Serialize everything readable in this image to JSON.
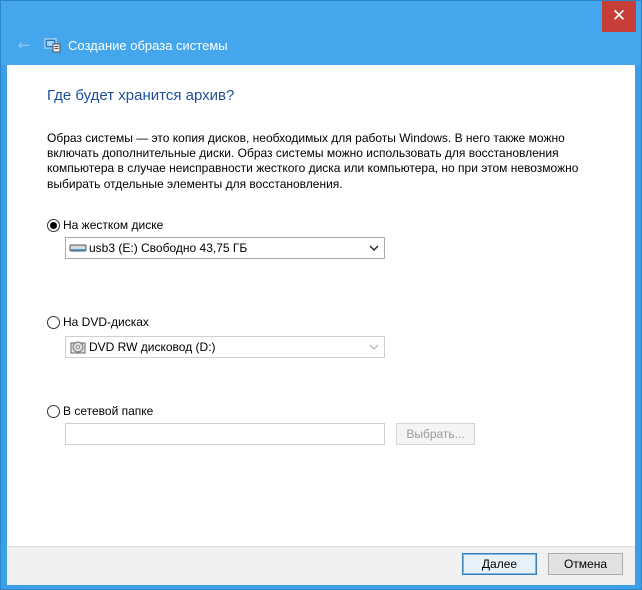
{
  "window": {
    "title": "Создание образа системы",
    "close_glyph": "✕",
    "back_glyph": "←",
    "accent_color": "#44a6ec",
    "close_color": "#c73e38"
  },
  "main": {
    "heading": "Где будет хранится архив?",
    "description": "Образ системы — это копия дисков, необходимых для работы Windows. В него также можно включать дополнительные диски. Образ системы можно использовать для восстановления компьютера в случае неисправности жесткого диска или компьютера, но при этом невозможно выбирать отдельные элементы для восстановления."
  },
  "options": {
    "hard_disk": {
      "label": "На жестком диске",
      "selected": true,
      "select_value": "usb3 (E:)  Свободно 43,75 ГБ"
    },
    "dvd": {
      "label": "На DVD-дисках",
      "selected": false,
      "select_value": "DVD RW дисковод (D:)"
    },
    "network": {
      "label": "В сетевой папке",
      "selected": false,
      "input_value": "",
      "browse_label": "Выбрать..."
    }
  },
  "footer": {
    "next_label": "Далее",
    "cancel_label": "Отмена"
  },
  "icons": {
    "chevron": "⌄",
    "back": "back-arrow-icon",
    "app": "backup-app-icon",
    "drive": "usb-drive-icon",
    "dvd": "dvd-drive-icon"
  }
}
